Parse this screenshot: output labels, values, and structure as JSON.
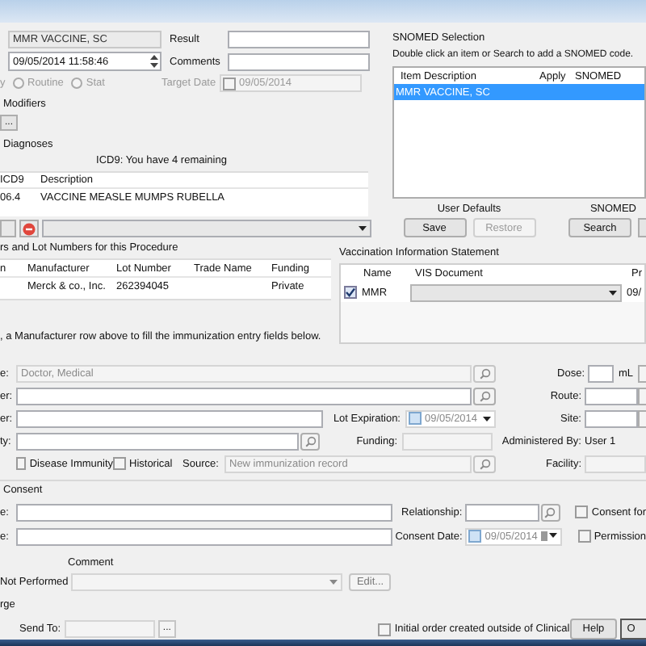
{
  "order": {
    "name": "MMR VACCINE, SC",
    "datetime": "09/05/2014 11:58:46",
    "result_label": "Result",
    "comments_label": "Comments",
    "priority_label": "y",
    "priority_options": [
      {
        "label": "Routine",
        "selected": false
      },
      {
        "label": "Stat",
        "selected": false
      }
    ],
    "target_date_label": "Target Date",
    "target_date": {
      "checked": false,
      "value": "09/05/2014"
    }
  },
  "modifiers": {
    "title": "Modifiers",
    "button": "..."
  },
  "diagnoses": {
    "title": "Diagnoses",
    "remaining": "ICD9: You have 4 remaining",
    "columns": [
      "ICD9",
      "Description"
    ],
    "rows": [
      {
        "code": "06.4",
        "description": "VACCINE MEASLE MUMPS RUBELLA"
      }
    ]
  },
  "snomed": {
    "title": "SNOMED Selection",
    "hint": "Double click an item or Search to add a SNOMED code.",
    "columns": [
      "Item Description",
      "Apply",
      "SNOMED"
    ],
    "rows": [
      {
        "description": "MMR VACCINE, SC",
        "selected": true
      }
    ],
    "user_defaults_title": "User Defaults",
    "buttons": [
      {
        "label": "Save",
        "disabled": false
      },
      {
        "label": "Restore",
        "disabled": true
      }
    ],
    "search_title": "SNOMED",
    "search_button": "Search"
  },
  "lots": {
    "title": "rs and Lot Numbers for this Procedure",
    "columns": [
      "n",
      "Manufacturer",
      "Lot Number",
      "Trade Name",
      "Funding"
    ],
    "rows": [
      {
        "manufacturer": "Merck & co., Inc.",
        "lot_number": "262394045",
        "funding": "Private"
      }
    ]
  },
  "vis": {
    "title": "Vaccination Information Statement",
    "columns": [
      "Name",
      "VIS Document",
      "Pr"
    ],
    "rows": [
      {
        "checked": true,
        "name": "MMR",
        "column_3": "09/"
      }
    ]
  },
  "instruction": ", a Manufacturer row above to fill the immunization entry fields below.",
  "immunization": {
    "row_labels": [
      "e:",
      "er:",
      "er:",
      "ty:"
    ],
    "provider": "Doctor, Medical",
    "lot_expiration_label": "Lot Expiration:",
    "lot_expiration": {
      "checked": false,
      "value": "09/05/2014"
    },
    "funding_label": "Funding:",
    "disease_immunity": {
      "label": "Disease Immunity",
      "checked": false
    },
    "historical": {
      "label": "Historical",
      "checked": false
    },
    "source_label": "Source:",
    "source": "New immunization record",
    "dose_label": "Dose:",
    "dose_unit": "mL",
    "route_label": "Route:",
    "site_label": "Site:",
    "administered_by_label": "Administered By:",
    "administered_by": "User 1",
    "facility_label": "Facility:"
  },
  "consent": {
    "title": "Consent",
    "row_labels": [
      "e:",
      "e:"
    ],
    "relationship_label": "Relationship:",
    "consent_date_label": "Consent Date:",
    "consent_date": {
      "checked": false,
      "value": "09/05/2014"
    },
    "options": [
      {
        "label": "Consent for",
        "checked": false
      },
      {
        "label": "Permission",
        "checked": false
      }
    ]
  },
  "not_performed": {
    "comment_label": "Comment",
    "label": "Not Performed",
    "edit_button": "Edit..."
  },
  "charge": {
    "title": "rge",
    "send_to_label": "Send To:",
    "send_to_button": "..."
  },
  "footer": {
    "outside_order": {
      "label": "Initial order created outside of Clinical",
      "checked": false
    },
    "buttons": [
      "Help",
      "O"
    ]
  }
}
